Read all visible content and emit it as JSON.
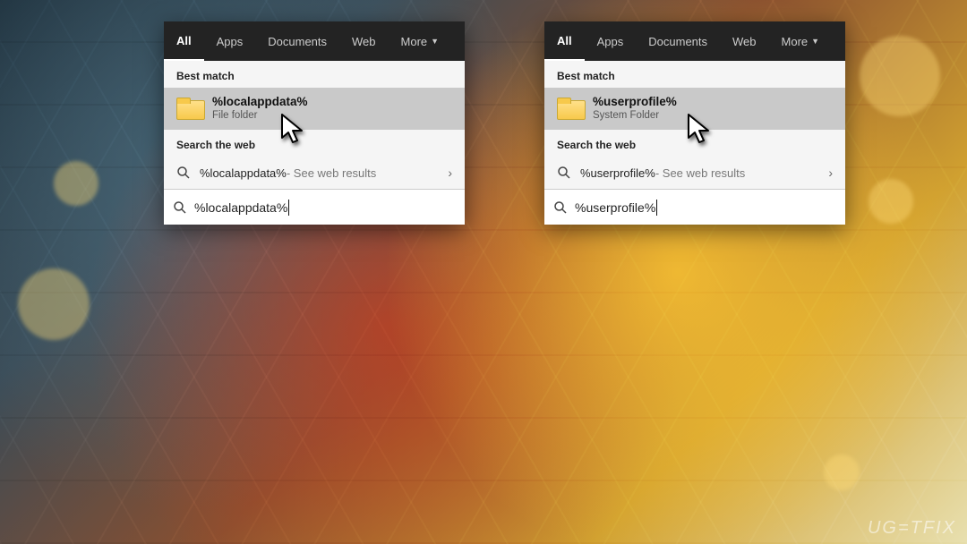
{
  "tabs": [
    "All",
    "Apps",
    "Documents",
    "Web",
    "More"
  ],
  "sections": {
    "best_match": "Best match",
    "search_web": "Search the web"
  },
  "web_suffix": " - See web results",
  "left": {
    "best_match": {
      "title": "%localappdata%",
      "subtitle": "File folder"
    },
    "web_query": "%localappdata%",
    "search_value": "%localappdata%"
  },
  "right": {
    "best_match": {
      "title": "%userprofile%",
      "subtitle": "System Folder"
    },
    "web_query": "%userprofile%",
    "search_value": "%userprofile%"
  },
  "watermark": "UG=TFIX"
}
